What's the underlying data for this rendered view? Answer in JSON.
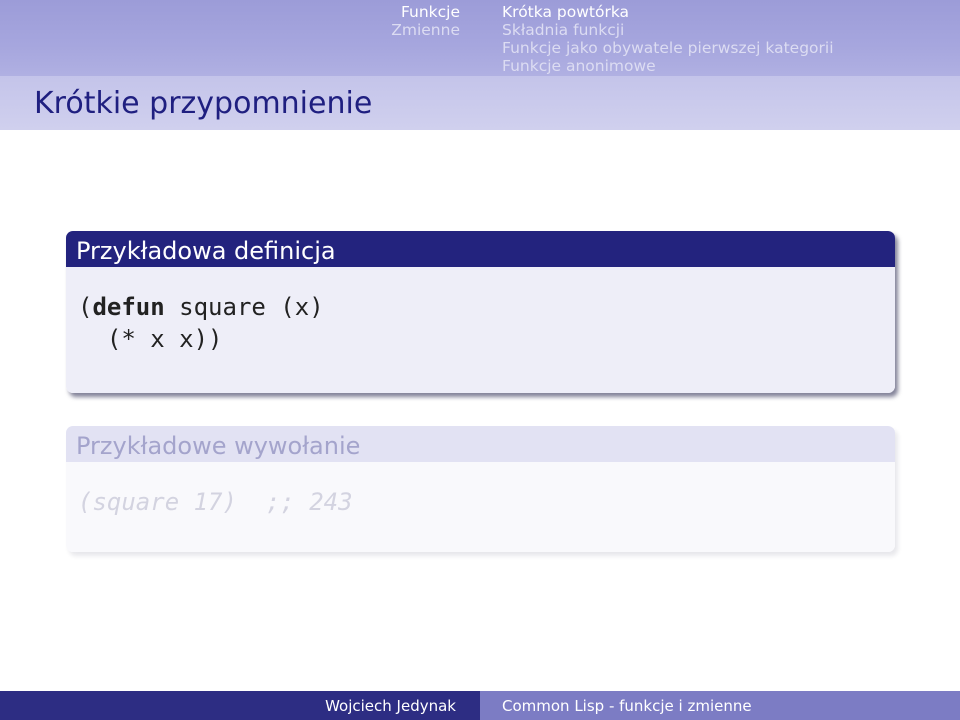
{
  "nav": {
    "sections": [
      {
        "label": "Funkcje",
        "active": true
      },
      {
        "label": "Zmienne",
        "active": false
      }
    ],
    "subsections": [
      {
        "label": "Krótka powtórka",
        "active": true
      },
      {
        "label": "Składnia funkcji",
        "active": false
      },
      {
        "label": "Funkcje jako obywatele pierwszej kategorii",
        "active": false
      },
      {
        "label": "Funkcje anonimowe",
        "active": false
      }
    ]
  },
  "frame": {
    "title": "Krótkie przypomnienie"
  },
  "blocks": [
    {
      "title": "Przykładowa definicja",
      "code": {
        "open_paren": "(",
        "keyword": "defun",
        "rest_line1": " square (x)",
        "line2": "  (* x x))"
      }
    },
    {
      "title": "Przykładowe wywołanie",
      "code": {
        "line1": "(square 17)  ;; 243"
      }
    }
  ],
  "footer": {
    "author": "Wojciech Jedynak",
    "talk_title": "Common Lisp - funkcje i zmienne"
  }
}
